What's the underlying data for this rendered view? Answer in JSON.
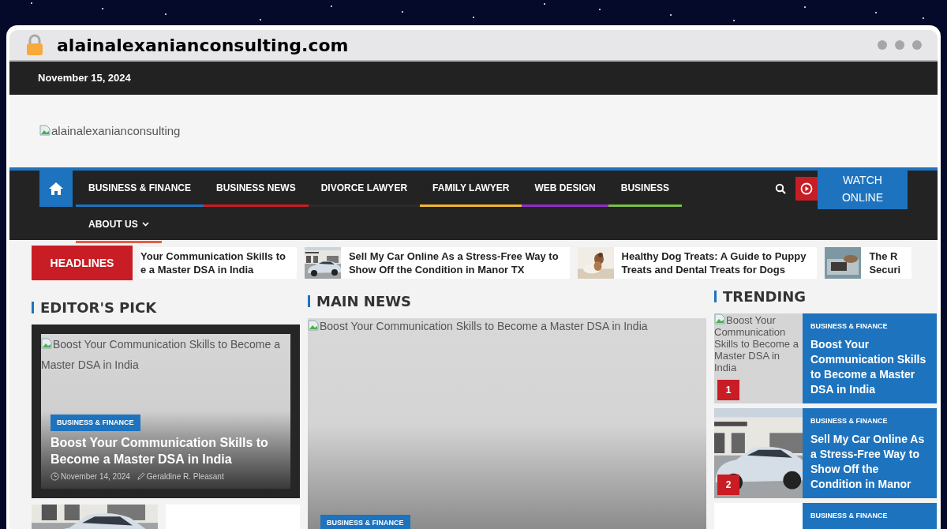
{
  "browser": {
    "url": "alainalexanianconsulting.com"
  },
  "top_bar": {
    "date": "November 15, 2024"
  },
  "logo": {
    "alt": "alainalexanianconsulting"
  },
  "nav": {
    "items": [
      {
        "label": "BUSINESS & FINANCE",
        "color": "#1e73be",
        "dropdown": false
      },
      {
        "label": "BUSINESS NEWS",
        "color": "#c81d25",
        "dropdown": false
      },
      {
        "label": "DIVORCE LAWYER",
        "color": "#2b2b2b",
        "dropdown": false
      },
      {
        "label": "FAMILY LAWYER",
        "color": "#f2b632",
        "dropdown": false
      },
      {
        "label": "WEB DESIGN",
        "color": "#8e2fc7",
        "dropdown": false
      },
      {
        "label": "BUSINESS",
        "color": "#7bc043",
        "dropdown": false
      },
      {
        "label": "ABOUT US",
        "color": "#e0604a",
        "dropdown": true
      }
    ],
    "watch_button": "WATCH ONLINE"
  },
  "ticker": {
    "label": "HEADLINES",
    "items": [
      {
        "thumbnail": false,
        "lines": [
          "Your Communication Skills to",
          "e a Master DSA in India"
        ]
      },
      {
        "thumbnail": true,
        "lines": [
          "Sell My Car Online As a Stress-Free Way to",
          "Show Off the Condition in Manor TX"
        ]
      },
      {
        "thumbnail": true,
        "lines": [
          "Healthy Dog Treats: A Guide to Puppy",
          "Treats and Dental Treats for Dogs"
        ]
      },
      {
        "thumbnail": true,
        "lines": [
          "The R",
          "Securi"
        ]
      }
    ]
  },
  "editors_pick": {
    "title": "EDITOR'S PICK",
    "featured": {
      "image_alt": "Boost Your Communication Skills to Become a Master DSA in India",
      "category": "BUSINESS & FINANCE",
      "title": "Boost Your Communication Skills to Become a Master DSA in India",
      "date": "November 14, 2024",
      "author": "Geraldine R. Pleasant"
    }
  },
  "main_news": {
    "title": "MAIN NEWS",
    "featured": {
      "image_alt": "Boost Your Communication Skills to Become a Master DSA in India",
      "category": "BUSINESS & FINANCE"
    }
  },
  "trending": {
    "title": "TRENDING",
    "items": [
      {
        "kind": "alt",
        "rank": "1",
        "image_alt": "Boost Your Communication Skills to Become a Master DSA in India",
        "category": "BUSINESS & FINANCE",
        "title": "Boost Your Communication Skills to Become a Master DSA in India"
      },
      {
        "kind": "picture",
        "rank": "2",
        "category": "BUSINESS & FINANCE",
        "title": "Sell My Car Online As a Stress-Free Way to Show Off the Condition in Manor"
      },
      {
        "kind": "blank",
        "category": "BUSINESS & FINANCE"
      }
    ]
  }
}
